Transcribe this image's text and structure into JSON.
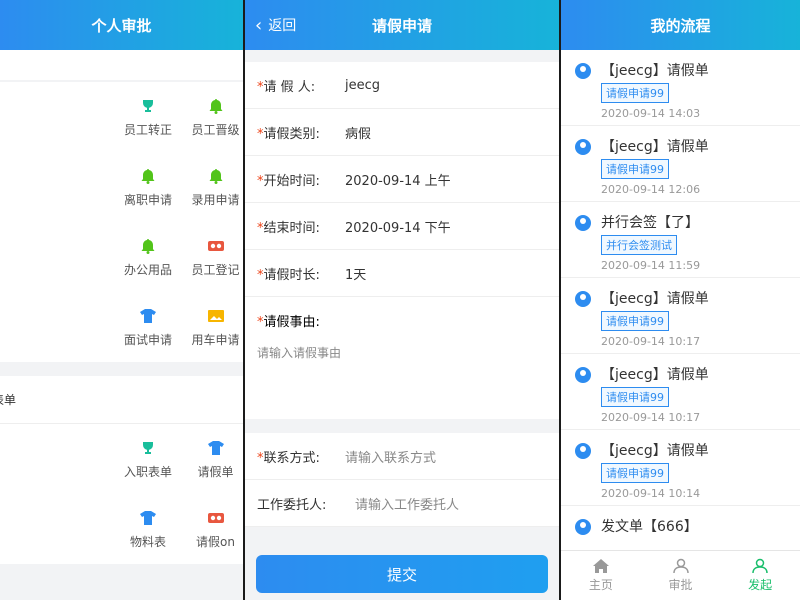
{
  "panel1": {
    "title": "个人审批",
    "section1": [
      {
        "label": "员工转正",
        "icon": "trophy-icon",
        "color": "#19be9b"
      },
      {
        "label": "员工晋级",
        "icon": "bell-icon",
        "color": "#52c41a"
      },
      {
        "label": "离职申请",
        "icon": "bell-icon",
        "color": "#52c41a"
      },
      {
        "label": "录用申请",
        "icon": "bell-icon",
        "color": "#52c41a"
      },
      {
        "label": "办公用品",
        "icon": "bell-icon",
        "color": "#52c41a"
      },
      {
        "label": "员工登记",
        "icon": "vr-glasses-icon",
        "color": "#e8573f"
      },
      {
        "label": "面试申请",
        "icon": "shirt-icon",
        "color": "#2d8cf0"
      },
      {
        "label": "用车申请",
        "icon": "picture-icon",
        "color": "#f7b500"
      }
    ],
    "section2_title": "表单",
    "section2": [
      {
        "label": "入职表单",
        "icon": "trophy-icon",
        "color": "#19be9b"
      },
      {
        "label": "请假单",
        "icon": "shirt-icon",
        "color": "#2d8cf0"
      },
      {
        "label": "物料表",
        "icon": "shirt-icon",
        "color": "#2d8cf0"
      },
      {
        "label": "请假on",
        "icon": "vr-glasses-icon",
        "color": "#e8573f"
      }
    ]
  },
  "panel2": {
    "back_label": "返回",
    "title": "请假申请",
    "fields": [
      {
        "key": "请 假 人:",
        "value": "jeecg",
        "placeholder": false,
        "required": true
      },
      {
        "key": "请假类别:",
        "value": "病假",
        "placeholder": false,
        "required": true
      },
      {
        "key": "开始时间:",
        "value": "2020-09-14 上午",
        "placeholder": false,
        "required": true
      },
      {
        "key": "结束时间:",
        "value": "2020-09-14 下午",
        "placeholder": false,
        "required": true
      },
      {
        "key": "请假时长:",
        "value": "1天",
        "placeholder": false,
        "required": true
      }
    ],
    "reason_key": "请假事由:",
    "reason_placeholder": "请输入请假事由",
    "contact_key": "联系方式:",
    "contact_placeholder": "请输入联系方式",
    "delegate_key": "工作委托人:",
    "delegate_placeholder": "请输入工作委托人",
    "submit_label": "提交"
  },
  "panel3": {
    "title": "我的流程",
    "items": [
      {
        "title": "【jeecg】请假单",
        "tag": "请假申请99",
        "time": "2020-09-14 14:03"
      },
      {
        "title": "【jeecg】请假单",
        "tag": "请假申请99",
        "time": "2020-09-14 12:06"
      },
      {
        "title": "并行会签【了】",
        "tag": "并行会签测试",
        "time": "2020-09-14 11:59"
      },
      {
        "title": "【jeecg】请假单",
        "tag": "请假申请99",
        "time": "2020-09-14 10:17"
      },
      {
        "title": "【jeecg】请假单",
        "tag": "请假申请99",
        "time": "2020-09-14 10:17"
      },
      {
        "title": "【jeecg】请假单",
        "tag": "请假申请99",
        "time": "2020-09-14 10:14"
      },
      {
        "title": "发文单【666】",
        "tag": "",
        "time": ""
      }
    ],
    "tabs": [
      {
        "label": "主页",
        "icon": "home-icon"
      },
      {
        "label": "审批",
        "icon": "user-icon"
      },
      {
        "label": "发起",
        "icon": "user-icon"
      }
    ],
    "active_tab": "发起",
    "accent_color": "#19be6b"
  }
}
